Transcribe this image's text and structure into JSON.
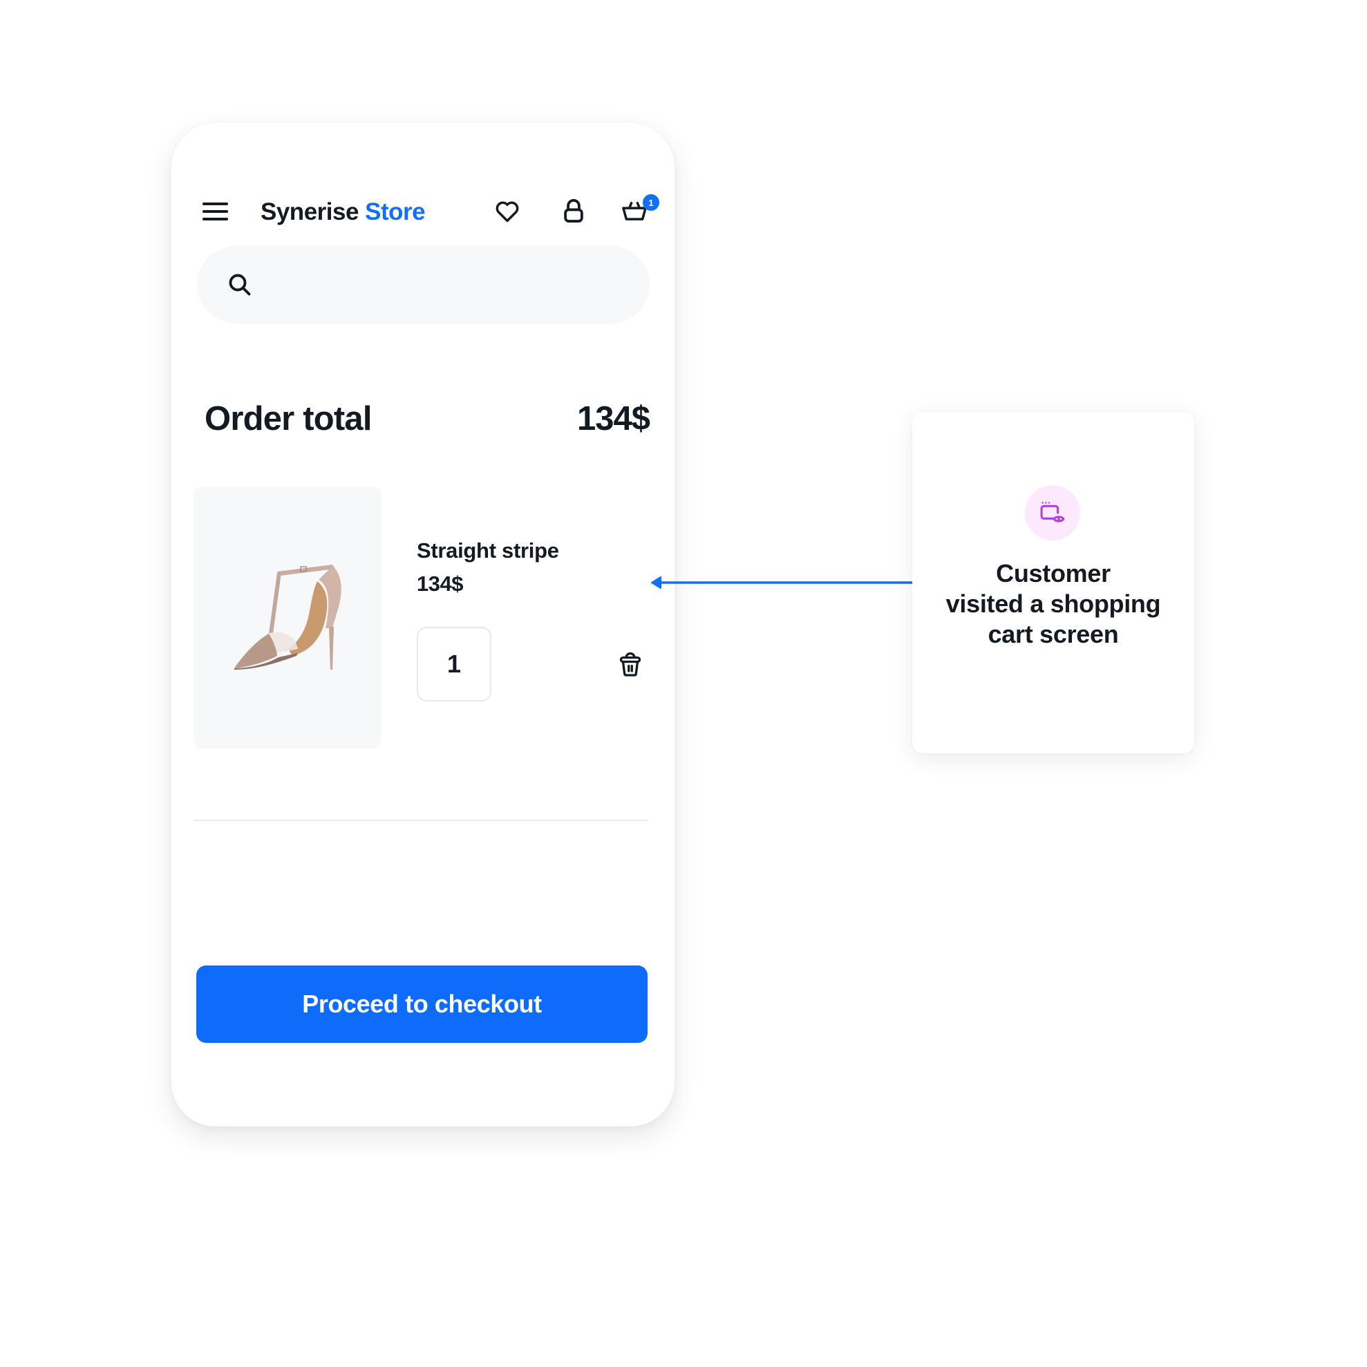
{
  "colors": {
    "accent": "#1170f5",
    "button": "#0f6cfb",
    "text": "#141a22",
    "event_icon": "#b23fd8",
    "event_icon_bg": "#fde9fd"
  },
  "header": {
    "menu_icon": "hamburger-menu-icon",
    "logo_primary": "Synerise",
    "logo_accent": "Store",
    "icons": [
      "heart-icon",
      "lock-icon",
      "basket-icon"
    ],
    "cart_badge_count": "1"
  },
  "search": {
    "icon": "search-icon",
    "value": "",
    "placeholder": ""
  },
  "order": {
    "label": "Order total",
    "total": "134$"
  },
  "cart_items": [
    {
      "image": "high-heel-shoe-image",
      "name": "Straight stripe",
      "price": "134$",
      "quantity": "1",
      "remove_icon": "trash-icon"
    }
  ],
  "checkout": {
    "label": "Proceed to checkout"
  },
  "event_card": {
    "icon": "screen-view-icon",
    "lines": [
      "Customer",
      "visited a shopping",
      "cart screen"
    ]
  }
}
